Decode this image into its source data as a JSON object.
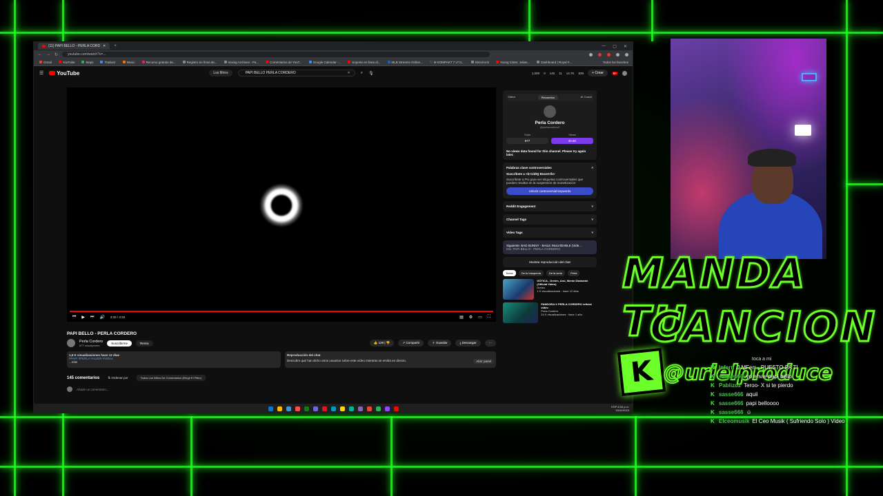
{
  "browser": {
    "tab_title": "(11) PAPI BELLO - PERLA CORD",
    "url": "youtube.com/watch?v=...",
    "bookmarks": [
      {
        "label": "Gmail",
        "color": "#ea4335"
      },
      {
        "label": "YouTube",
        "color": "#ff0000"
      },
      {
        "label": "Maps",
        "color": "#34a853"
      },
      {
        "label": "Traducir",
        "color": "#4285f4"
      },
      {
        "label": "Music",
        "color": "#ff6f00"
      },
      {
        "label": "Recurso gratuito de...",
        "color": "#e91e63"
      },
      {
        "label": "Registro en línea de...",
        "color": "#888888"
      },
      {
        "label": "mixing Archives - Pa...",
        "color": "#888888"
      },
      {
        "label": "Comentarios de YouT...",
        "color": "#ff0000"
      },
      {
        "label": "Google Calendar -...",
        "color": "#4285f4"
      },
      {
        "label": "Soporte en linea di...",
        "color": "#ff0000"
      },
      {
        "label": "MLB Streams Online...",
        "color": "#1565c0"
      },
      {
        "label": "M KOMPAKT 7 v7.0...",
        "color": "#444444"
      },
      {
        "label": "Directrock",
        "color": "#888888"
      },
      {
        "label": "Young Cister, Julian...",
        "color": "#ff0000"
      },
      {
        "label": "Dashboard | Royal F...",
        "color": "#888888"
      }
    ],
    "all_bookmarks": "Todos los favoritos"
  },
  "yt": {
    "logo": "YouTube",
    "filter": "Los filtros",
    "search_value": "PAPI BELLO PERLA CORDERO",
    "header_stats": [
      "1,009",
      "0",
      "146",
      "11",
      "14.7K",
      "839"
    ],
    "create_label": "+ Crear",
    "notif_badge": "9+"
  },
  "player": {
    "time": "3:33 / 3:33",
    "progress": 1.0
  },
  "video": {
    "title": "PAPI BELLO - PERLA CORDERO",
    "channel": "Perla Cordero",
    "subscribers": "877 suscriptores",
    "subscribe_label": "Suscribirme",
    "remix_label": "Remix",
    "likes": "129",
    "share_label": "Compartir",
    "save_label": "Guardar",
    "download_label": "Descargar",
    "views_line": "1,5 K visualizaciones  hace 12 días",
    "tags": "#PAPI #PERLA #ALIEN #VIRAL",
    "more": "...más",
    "chat_replay_title": "Reproducción del chat",
    "chat_replay_text": "Descubre qué han dicho otros usuarios sobre este vídeo mientras se emitía en directo.",
    "chat_replay_open": "Abrir panel",
    "comments_count": "145 comentarios",
    "sort_label": "Ordenar por",
    "ext_filter": "Todos Los Niños De Comentarios (Elegir El Filtro)",
    "add_comment": "Añade un comentario..."
  },
  "side": {
    "tabs": [
      "Visitor",
      "Recuentos",
      "AI Coach"
    ],
    "active_tab": 1,
    "profile_name": "Perla Cordero",
    "profile_handle": "@perlacordero0",
    "stats_labels": [
      "Subs",
      "Views"
    ],
    "stats_values": [
      "877",
      "30.6K"
    ],
    "no_views": "No views data found for this channel. Please try again later.",
    "controversial_title": "Palabras clave controversiales",
    "controversial_sub": "Suscríbete a <b>vidIQ Boost</b>",
    "controversial_body": "Suscríbete a Pro para ver etiquetas controversiales que pueden resultar en la suspensión de monetización",
    "unlock_label": "Unlock controversial keywords",
    "sections": [
      "Reddit Engagement",
      "Channel Tags",
      "Video Tags"
    ],
    "now_playing": "Siguiente: BAD BUNNY - BAILE INoLVIDABLE (Vide...",
    "now_playing_sub": "Mix: PAPI BELLO - PERLA CORDERO",
    "show_chat": "Mostrar reproducción del chat",
    "chips": [
      "Todos",
      "De tu búsqueda",
      "De la serie",
      "Perla"
    ],
    "recs": [
      {
        "title": "GÓTICA - Drelen, Anú, Mente Diamante (Official Video)",
        "channel": "Drelen",
        "meta": "1 K visualizaciones · hace 12 días"
      },
      {
        "title": "PANDORA X PERLA CORDERO /oficial video",
        "channel": "Perla Cordero",
        "meta": "24 K visualizaciones · hace 1 año"
      }
    ]
  },
  "taskbar": {
    "time": "8:34 p.m.",
    "date": "15/11/2023",
    "lang": "ESP"
  },
  "overlay": {
    "line1": "MANDA TU",
    "line2": "CANCION",
    "handle": "@urielproduce",
    "k": "K"
  },
  "chat": {
    "top": "toca a mi",
    "messages": [
      {
        "user": "Infern",
        "text": "J MFerr - PUESTO PA TI"
      },
      {
        "user": "sasse666",
        "text": "yo envie papi bello"
      },
      {
        "user": "Pablizoz",
        "text": "Teroo- X si te pierdo"
      },
      {
        "user": "sasse666",
        "text": "aquii"
      },
      {
        "user": "sasse666",
        "text": "papi belloooo"
      },
      {
        "user": "sasse666",
        "text": "☺"
      },
      {
        "user": "Elceomusik",
        "text": "El Ceo Musik ( Sufriendo Solo ) Video"
      }
    ]
  },
  "colors": {
    "neon": "#6cff2a",
    "yt_red": "#ff0000",
    "vidiq_purple": "#7c3aed"
  }
}
